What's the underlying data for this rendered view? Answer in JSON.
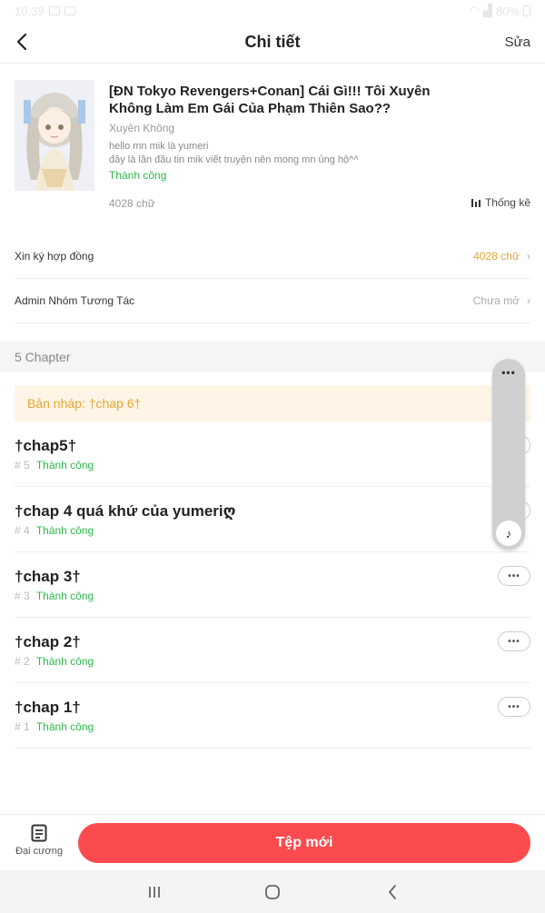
{
  "status_bar": {
    "time": "10:39",
    "battery": "80%"
  },
  "header": {
    "title": "Chi tiết",
    "edit_label": "Sửa"
  },
  "book": {
    "title": "[ĐN Tokyo Revengers+Conan] Cái Gì!!! Tôi Xuyên Không Làm Em Gái Của Phạm Thiên Sao??",
    "genre": "Xuyên Không",
    "description_line1": "hello mn mik là yumeri",
    "description_line2": "đây là lần đầu tin mik viết truyện nên mong mn ủng hộ^^",
    "status": "Thành công",
    "word_count": "4028 chữ",
    "stats_label": "Thống kê"
  },
  "settings": [
    {
      "label": "Xin ký hợp đồng",
      "value": "4028 chữ",
      "value_color": "#e8a330"
    },
    {
      "label": "Admin Nhóm Tương Tác",
      "value": "Chưa mở",
      "value_color": "#aaaaaa"
    }
  ],
  "chapter_header": "5 Chapter",
  "draft_label": "Bản nháp: †chap 6†",
  "chapters": [
    {
      "title": "†chap5†",
      "number": "# 5",
      "status": "Thành công"
    },
    {
      "title": "†chap 4 quá khứ của yumeriღ",
      "number": "# 4",
      "status": "Thành công"
    },
    {
      "title": "†chap 3†",
      "number": "# 3",
      "status": "Thành công"
    },
    {
      "title": "†chap 2†",
      "number": "# 2",
      "status": "Thành công"
    },
    {
      "title": "†chap 1†",
      "number": "# 1",
      "status": "Thành công"
    }
  ],
  "more_label": "•••",
  "floating": {
    "dots": "•••",
    "music_icon": "♪"
  },
  "bottom": {
    "outline_label": "Đại cương",
    "new_file_label": "Tệp mới"
  },
  "colors": {
    "accent_red": "#fc4b4e",
    "success_green": "#2db84c",
    "draft_orange": "#e8a330"
  }
}
